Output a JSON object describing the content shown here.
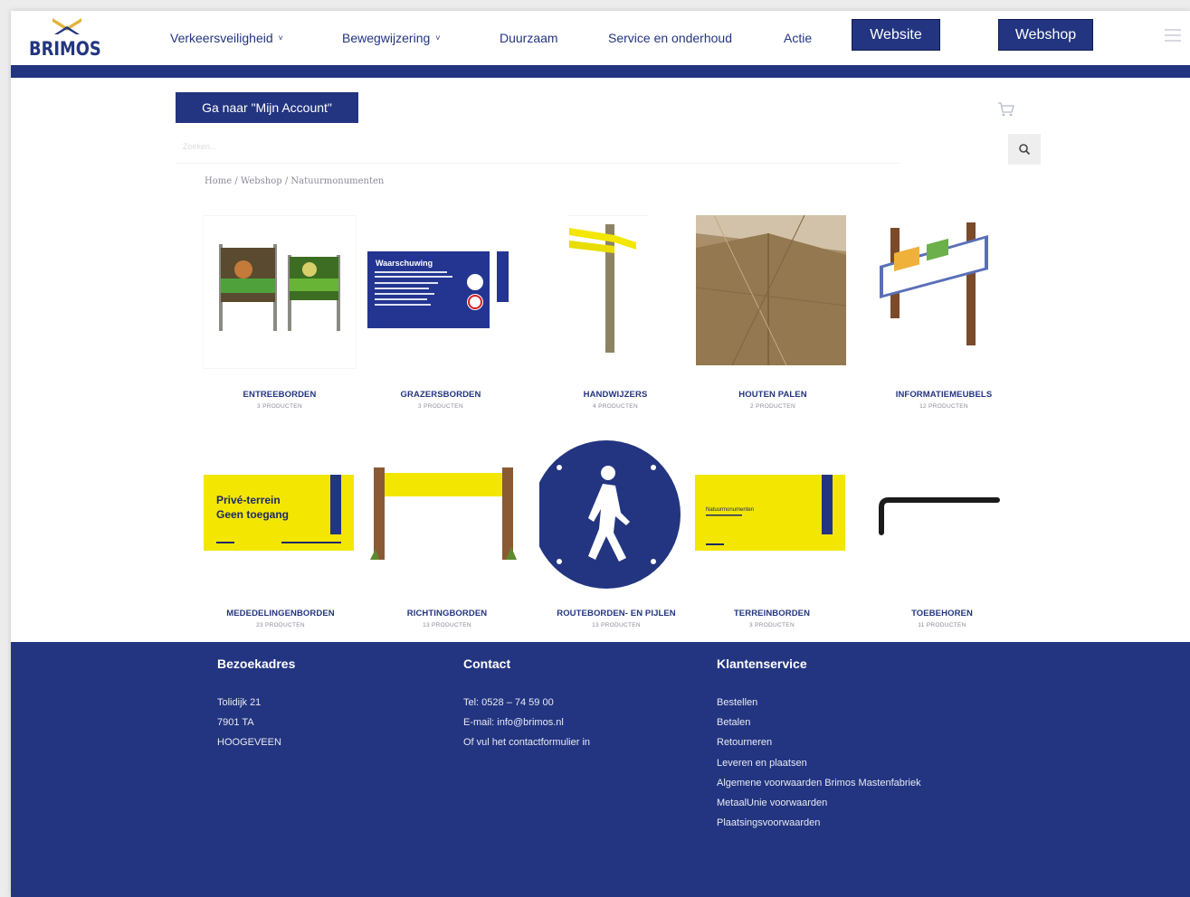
{
  "header": {
    "logo_text": "BRIMOS",
    "nav": [
      {
        "label": "Verkeersveiligheid",
        "has_dropdown": true
      },
      {
        "label": "Bewegwijzering",
        "has_dropdown": true
      },
      {
        "label": "Duurzaam",
        "has_dropdown": false
      },
      {
        "label": "Service en onderhoud",
        "has_dropdown": false
      },
      {
        "label": "Actie",
        "has_dropdown": false
      }
    ],
    "website_label": "Website",
    "webshop_label": "Webshop",
    "chevron": "˅"
  },
  "account_button": "Ga naar \"Mijn Account\"",
  "search": {
    "placeholder": "Zoeken..."
  },
  "breadcrumb": "Home / Webshop / Natuurmonumenten",
  "categories": [
    {
      "name": "ENTREEBORDEN",
      "count": "3 PRODUCTEN"
    },
    {
      "name": "GRAZERSBORDEN",
      "count": "3 PRODUCTEN"
    },
    {
      "name": "HANDWIJZERS",
      "count": "4 PRODUCTEN"
    },
    {
      "name": "HOUTEN PALEN",
      "count": "2 PRODUCTEN"
    },
    {
      "name": "INFORMATIEMEUBELS",
      "count": "12 PRODUCTEN"
    },
    {
      "name": "MEDEDELINGENBORDEN",
      "count": "23 PRODUCTEN"
    },
    {
      "name": "RICHTINGBORDEN",
      "count": "13 PRODUCTEN"
    },
    {
      "name": "ROUTEBORDEN- EN PIJLEN",
      "count": "13 PRODUCTEN"
    },
    {
      "name": "TERREINBORDEN",
      "count": "3 PRODUCTEN"
    },
    {
      "name": "TOEBEHOREN",
      "count": "11 PRODUCTEN"
    }
  ],
  "images": {
    "waarschuwing": "Waarschuwing",
    "prive_line1": "Privé-terrein",
    "prive_line2": "Geen toegang",
    "terrein_text": "Natuurmonumenten"
  },
  "footer": {
    "visit": {
      "title": "Bezoekadres",
      "lines": [
        "Tolidijk 21",
        "7901 TA",
        "HOOGEVEEN"
      ]
    },
    "contact": {
      "title": "Contact",
      "lines": [
        "Tel: 0528 – 74 59 00",
        "E-mail: info@brimos.nl",
        "Of vul het contactformulier in"
      ]
    },
    "service": {
      "title": "Klantenservice",
      "lines": [
        "Bestellen",
        "Betalen",
        "Retourneren",
        "Leveren en plaatsen",
        "Algemene voorwaarden Brimos Mastenfabriek",
        "MetaalUnie voorwaarden",
        "Plaatsingsvoorwaarden"
      ]
    }
  },
  "colors": {
    "brand_navy": "#233580",
    "accent_yellow": "#f3e600",
    "logo_gold": "#e3b33a"
  },
  "icons": [
    "cart-icon",
    "search-icon",
    "menu-icon",
    "chevron-down-icon"
  ]
}
